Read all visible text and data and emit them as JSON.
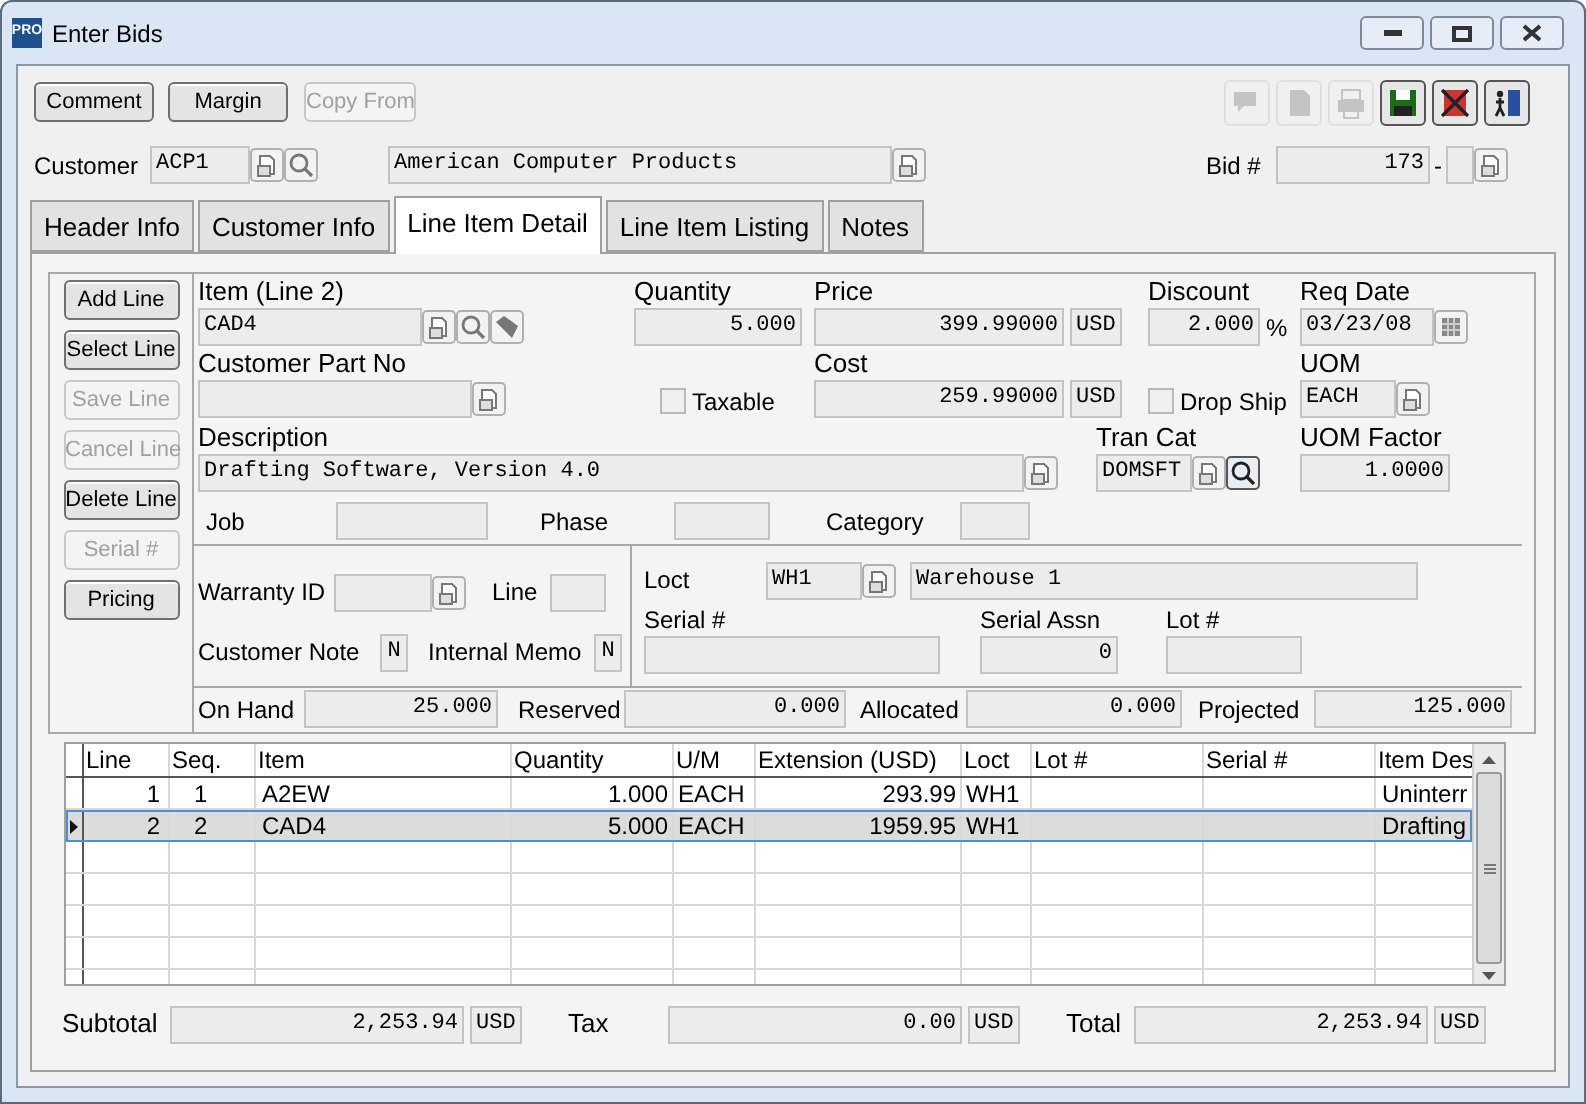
{
  "window": {
    "badge": "PRO",
    "title": "Enter Bids"
  },
  "toolbar": {
    "buttons": [
      {
        "label": "Comment",
        "disabled": false
      },
      {
        "label": "Margin",
        "disabled": false
      },
      {
        "label": "Copy From",
        "disabled": true
      }
    ],
    "icons": [
      {
        "kind": "chat",
        "disabled": true
      },
      {
        "kind": "note",
        "disabled": true
      },
      {
        "kind": "print",
        "disabled": true
      },
      {
        "kind": "save",
        "disabled": false
      },
      {
        "kind": "delete",
        "disabled": false
      },
      {
        "kind": "exit",
        "disabled": false
      }
    ]
  },
  "customer": {
    "label": "Customer",
    "code": "ACP1",
    "name": "American Computer Products",
    "bid_label": "Bid #",
    "bid_number": "173",
    "separator": "-"
  },
  "tabs": [
    {
      "label": "Header Info",
      "selected": false
    },
    {
      "label": "Customer Info",
      "selected": false
    },
    {
      "label": "Line Item Detail",
      "selected": true
    },
    {
      "label": "Line Item Listing",
      "selected": false
    },
    {
      "label": "Notes",
      "selected": false
    }
  ],
  "line_buttons": [
    {
      "label": "Add Line",
      "disabled": false
    },
    {
      "label": "Select Line",
      "disabled": false
    },
    {
      "label": "Save Line",
      "disabled": true
    },
    {
      "label": "Cancel Line",
      "disabled": true
    },
    {
      "label": "Delete Line",
      "disabled": false
    },
    {
      "label": "Serial #",
      "disabled": true
    },
    {
      "label": "Pricing",
      "disabled": false
    }
  ],
  "detail": {
    "item_label": "Item (Line 2)",
    "item": "CAD4",
    "quantity_label": "Quantity",
    "quantity": "5.000",
    "price_label": "Price",
    "price": "399.99000",
    "price_currency": "USD",
    "discount_label": "Discount",
    "discount": "2.000",
    "percent": "%",
    "req_date_label": "Req Date",
    "req_date": "03/23/08",
    "customer_part_label": "Customer Part No",
    "taxable": {
      "label": "Taxable",
      "checked": false
    },
    "cost_label": "Cost",
    "cost": "259.99000",
    "cost_currency": "USD",
    "drop_ship": {
      "label": "Drop Ship",
      "checked": false
    },
    "uom_label": "UOM",
    "uom": "EACH",
    "description_label": "Description",
    "description": "Drafting Software, Version 4.0",
    "tran_cat_label": "Tran Cat",
    "tran_cat": "DOMSFT",
    "uom_factor_label": "UOM Factor",
    "uom_factor": "1.0000",
    "job_label": "Job",
    "phase_label": "Phase",
    "category_label": "Category",
    "warranty_label": "Warranty ID",
    "line_label": "Line",
    "customer_note_label": "Customer Note",
    "customer_note": "N",
    "internal_memo_label": "Internal Memo",
    "internal_memo": "N",
    "loct_label": "Loct",
    "loct": "WH1",
    "warehouse": "Warehouse 1",
    "serial_label": "Serial #",
    "serial_assn_label": "Serial Assn",
    "serial_assn": "0",
    "lot_label": "Lot #",
    "on_hand_label": "On Hand",
    "on_hand": "25.000",
    "reserved_label": "Reserved",
    "reserved": "0.000",
    "allocated_label": "Allocated",
    "allocated": "0.000",
    "projected_label": "Projected",
    "projected": "125.000"
  },
  "grid": {
    "columns": [
      "Line",
      "Seq.",
      "Item",
      "Quantity",
      "U/M",
      "Extension (USD)",
      "Loct",
      "Lot #",
      "Serial #",
      "Item Des"
    ],
    "rows": [
      {
        "selected": false,
        "cells": [
          "1",
          "1",
          "A2EW",
          "1.000",
          "EACH",
          "293.99",
          "WH1",
          "",
          "",
          "Uninterr"
        ]
      },
      {
        "selected": true,
        "cells": [
          "2",
          "2",
          "CAD4",
          "5.000",
          "EACH",
          "1959.95",
          "WH1",
          "",
          "",
          "Drafting"
        ]
      }
    ]
  },
  "totals": [
    {
      "label": "Subtotal",
      "value": "2,253.94",
      "currency": "USD"
    },
    {
      "label": "Tax",
      "value": "0.00",
      "currency": "USD"
    },
    {
      "label": "Total",
      "value": "2,253.94",
      "currency": "USD"
    }
  ]
}
